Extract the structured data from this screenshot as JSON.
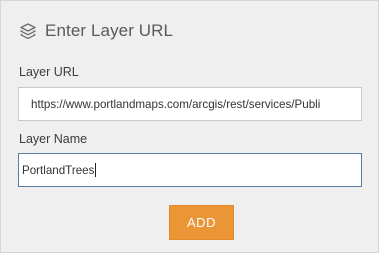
{
  "dialog": {
    "title": "Enter Layer URL",
    "title_icon": "layers-icon"
  },
  "layer_url": {
    "label": "Layer URL",
    "value": "https://www.portlandmaps.com/arcgis/rest/services/Publi"
  },
  "layer_name": {
    "label": "Layer Name",
    "value": "PortlandTrees"
  },
  "actions": {
    "add_label": "ADD"
  },
  "colors": {
    "panel_background": "#efefef",
    "add_button": "#ea9536",
    "focused_border": "#5a7fa6"
  }
}
